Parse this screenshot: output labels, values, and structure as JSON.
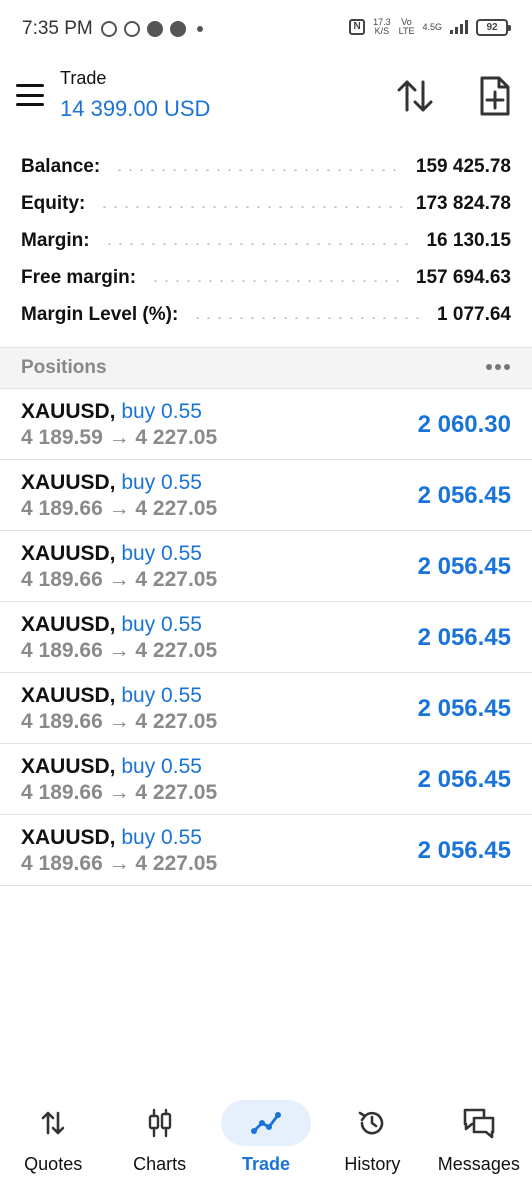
{
  "status_bar": {
    "time": "7:35 PM",
    "speed": "17.3",
    "speed_unit": "K/S",
    "net1": "Vo",
    "net1b": "LTE",
    "net2": "4.5G",
    "battery": "92"
  },
  "header": {
    "title": "Trade",
    "subtitle": "14 399.00 USD"
  },
  "summary": [
    {
      "label": "Balance:",
      "value": "159 425.78"
    },
    {
      "label": "Equity:",
      "value": "173 824.78"
    },
    {
      "label": "Margin:",
      "value": "16 130.15"
    },
    {
      "label": "Free margin:",
      "value": "157 694.63"
    },
    {
      "label": "Margin Level (%):",
      "value": "1 077.64"
    }
  ],
  "positions": {
    "title": "Positions",
    "items": [
      {
        "symbol": "XAUUSD,",
        "side": "buy 0.55",
        "prices": "4 189.59 → 4 227.05",
        "profit": "2 060.30"
      },
      {
        "symbol": "XAUUSD,",
        "side": "buy 0.55",
        "prices": "4 189.66 → 4 227.05",
        "profit": "2 056.45"
      },
      {
        "symbol": "XAUUSD,",
        "side": "buy 0.55",
        "prices": "4 189.66 → 4 227.05",
        "profit": "2 056.45"
      },
      {
        "symbol": "XAUUSD,",
        "side": "buy 0.55",
        "prices": "4 189.66 → 4 227.05",
        "profit": "2 056.45"
      },
      {
        "symbol": "XAUUSD,",
        "side": "buy 0.55",
        "prices": "4 189.66 → 4 227.05",
        "profit": "2 056.45"
      },
      {
        "symbol": "XAUUSD,",
        "side": "buy 0.55",
        "prices": "4 189.66 → 4 227.05",
        "profit": "2 056.45"
      },
      {
        "symbol": "XAUUSD,",
        "side": "buy 0.55",
        "prices": "4 189.66 → 4 227.05",
        "profit": "2 056.45"
      }
    ]
  },
  "nav": [
    {
      "label": "Quotes",
      "icon": "quotes-icon"
    },
    {
      "label": "Charts",
      "icon": "charts-icon"
    },
    {
      "label": "Trade",
      "icon": "trade-icon",
      "active": true
    },
    {
      "label": "History",
      "icon": "history-icon"
    },
    {
      "label": "Messages",
      "icon": "messages-icon"
    }
  ],
  "colors": {
    "accent": "#1a73d9",
    "muted": "#8a8a8a",
    "section_bg": "#f4f4f4",
    "active_pill": "#e6f0fc"
  }
}
